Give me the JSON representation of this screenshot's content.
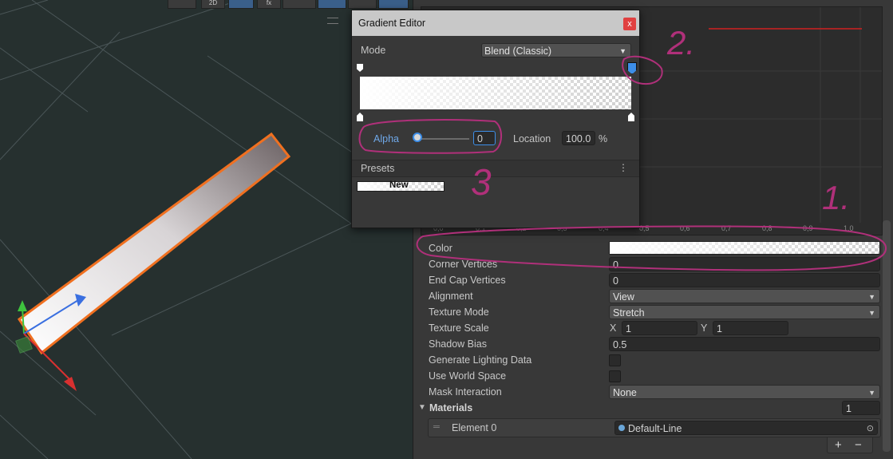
{
  "scene_toolbar": {
    "mode_2d": "2D",
    "fx_label": "fx"
  },
  "gradient_editor": {
    "title": "Gradient Editor",
    "close": "x",
    "mode_label": "Mode",
    "mode_value": "Blend (Classic)",
    "alpha_label": "Alpha",
    "alpha_value": "0",
    "alpha_slider_fraction": 0.0,
    "location_label": "Location",
    "location_value": "100.0",
    "location_unit": "%",
    "presets_label": "Presets",
    "preset_name": "New"
  },
  "curve": {
    "x_ticks": [
      "0,0",
      "0,1",
      "0,2",
      "0,3",
      "0,4",
      "0,5",
      "0,6",
      "0,7",
      "0,8",
      "0,9",
      "1,0"
    ]
  },
  "inspector": {
    "color_label": "Color",
    "corner_vertices_label": "Corner Vertices",
    "corner_vertices_value": "0",
    "end_cap_label": "End Cap Vertices",
    "end_cap_value": "0",
    "alignment_label": "Alignment",
    "alignment_value": "View",
    "texture_mode_label": "Texture Mode",
    "texture_mode_value": "Stretch",
    "texture_scale_label": "Texture Scale",
    "texture_scale_x_label": "X",
    "texture_scale_x": "1",
    "texture_scale_y_label": "Y",
    "texture_scale_y": "1",
    "shadow_bias_label": "Shadow Bias",
    "shadow_bias_value": "0.5",
    "gen_lighting_label": "Generate Lighting Data",
    "world_space_label": "Use World Space",
    "mask_label": "Mask Interaction",
    "mask_value": "None",
    "materials_label": "Materials",
    "materials_count": "1",
    "element0_label": "Element 0",
    "element0_value": "Default-Line",
    "add_label": "+",
    "remove_label": "−"
  },
  "annotations": {
    "one": "1.",
    "two": "2.",
    "three": "3"
  },
  "colors": {
    "accent_blue": "#3d8ee8",
    "annotation": "#b0307a",
    "selection_outline": "#f07020",
    "curve_line": "#d02020"
  }
}
